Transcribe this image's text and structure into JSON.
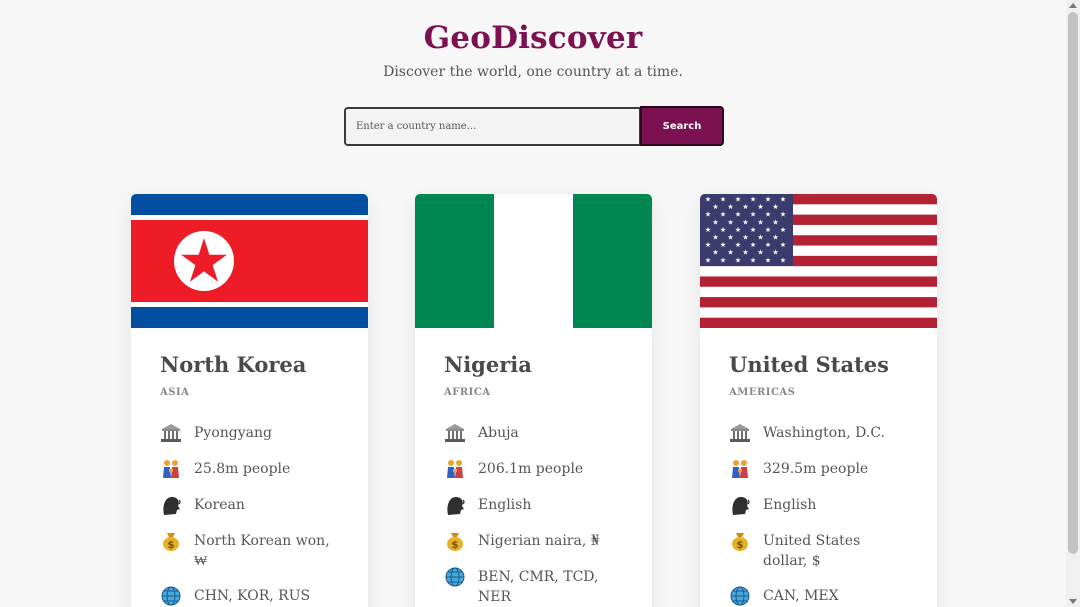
{
  "header": {
    "title": "GeoDiscover",
    "subtitle": "Discover the world, one country at a time."
  },
  "search": {
    "placeholder": "Enter a country name...",
    "value": "",
    "button_label": "Search"
  },
  "icons": {
    "capital": "classical-building-icon",
    "population": "people-icon",
    "language": "speaking-head-icon",
    "currency": "money-bag-icon",
    "borders": "globe-icon"
  },
  "colors": {
    "brand": "#7b1150",
    "north_korea_flag": [
      "#024fa2",
      "#ed1c27",
      "#ffffff"
    ],
    "nigeria_flag": [
      "#008751",
      "#ffffff"
    ],
    "usa_flag": [
      "#b22234",
      "#3c3b6e",
      "#ffffff"
    ]
  },
  "cards": [
    {
      "name": "North Korea",
      "region": "ASIA",
      "capital": "Pyongyang",
      "population": "25.8m people",
      "language": "Korean",
      "currency": "North Korean won, ₩",
      "borders": "CHN, KOR, RUS"
    },
    {
      "name": "Nigeria",
      "region": "AFRICA",
      "capital": "Abuja",
      "population": "206.1m people",
      "language": "English",
      "currency": "Nigerian naira, ₦",
      "borders": "BEN, CMR, TCD, NER"
    },
    {
      "name": "United States",
      "region": "AMERICAS",
      "capital": "Washington, D.C.",
      "population": "329.5m people",
      "language": "English",
      "currency": "United States dollar, $",
      "borders": "CAN, MEX"
    }
  ]
}
